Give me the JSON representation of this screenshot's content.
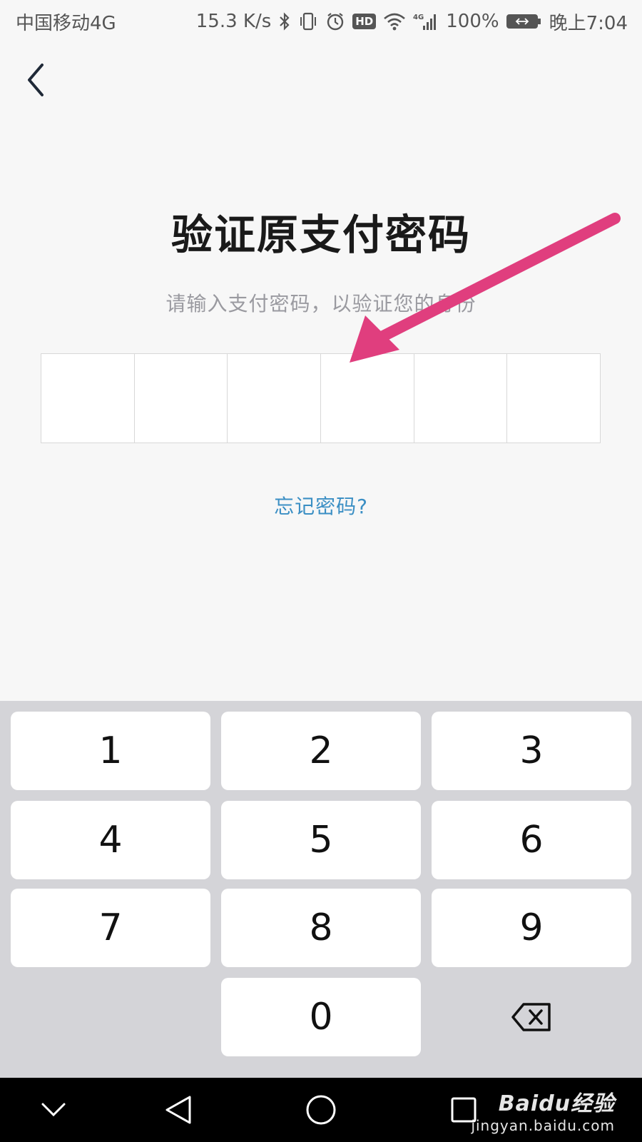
{
  "status_bar": {
    "carrier": "中国移动4G",
    "speed": "15.3 K/s",
    "hd": "HD",
    "battery": "100%",
    "time": "晚上7:04",
    "icons": [
      "bluetooth-icon",
      "vibrate-icon",
      "alarm-icon",
      "hd-icon",
      "wifi-icon",
      "signal-icon",
      "battery-charging-icon"
    ]
  },
  "header": {
    "back_icon": "chevron-left-icon"
  },
  "main": {
    "title": "验证原支付密码",
    "subtitle": "请输入支付密码，以验证您的身份",
    "pin_boxes": [
      "",
      "",
      "",
      "",
      "",
      ""
    ],
    "forgot_label": "忘记密码?"
  },
  "annotation": {
    "arrow_color": "#e03e7e"
  },
  "keypad": {
    "keys": [
      "1",
      "2",
      "3",
      "4",
      "5",
      "6",
      "7",
      "8",
      "9",
      "0"
    ],
    "delete_icon": "backspace-icon"
  },
  "nav": {
    "icons": [
      "chevron-down-icon",
      "back-triangle-icon",
      "home-circle-icon",
      "recents-square-icon"
    ]
  },
  "watermark": {
    "brand": "Baidu经验",
    "url": "jingyan.baidu.com"
  }
}
